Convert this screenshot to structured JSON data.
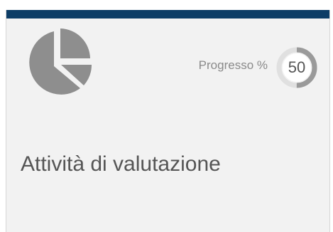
{
  "tile": {
    "title": "Attività di valutazione",
    "icon": "pie-chart-icon",
    "progress": {
      "label": "Progresso %",
      "value": "50",
      "fraction": 0.5
    }
  },
  "colors": {
    "topbar": "#0d3d66",
    "tile_background": "#f2f2f2",
    "icon_gray": "#8e8e8e",
    "ring_track": "#e0e0e0",
    "ring_fill": "#9a9a9a",
    "text_gray": "#555555"
  }
}
